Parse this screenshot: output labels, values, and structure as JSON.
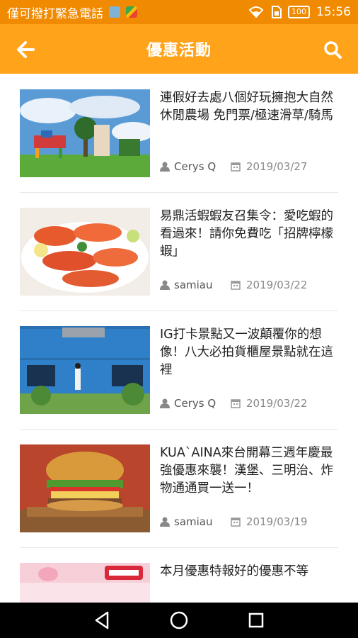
{
  "status_bar": {
    "carrier_text": "僅可撥打緊急電話",
    "battery": "100",
    "time": "15:56"
  },
  "app_bar": {
    "title": "優惠活動"
  },
  "articles": [
    {
      "title": "連假好去處八個好玩擁抱大自然休閒農場 免門票/極速滑草/騎馬",
      "author": "Cerys Q",
      "date": "2019/03/27",
      "image": "farm-photo"
    },
    {
      "title": "易鼎活蝦蝦友召集令：愛吃蝦的看過來！請你免費吃「招牌檸檬蝦」",
      "author": "samiau",
      "date": "2019/03/22",
      "image": "shrimp-photo"
    },
    {
      "title": "IG打卡景點又一波顛覆你的想像！八大必拍貨櫃屋景點就在這裡",
      "author": "Cerys Q",
      "date": "2019/03/22",
      "image": "container-house-photo"
    },
    {
      "title": "KUA`AINA來台開幕三週年慶最強優惠來襲！漢堡、三明治、炸物通通買一送一！",
      "author": "samiau",
      "date": "2019/03/19",
      "image": "burger-photo"
    },
    {
      "title": "本月優惠特報好的優惠不等",
      "author": "",
      "date": "",
      "image": "donut-banner"
    }
  ],
  "colors": {
    "status_bar": "#f08a00",
    "app_bar": "#ffa31a"
  }
}
